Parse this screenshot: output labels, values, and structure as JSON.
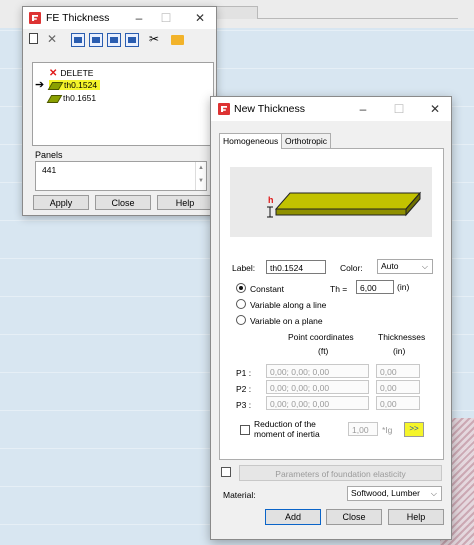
{
  "fe_window": {
    "title": "FE Thickness",
    "list_items": [
      {
        "label": "DELETE",
        "icon": "delete-x-icon"
      },
      {
        "label": "th0.1524",
        "icon": "plate-icon",
        "highlighted": true,
        "current": true
      },
      {
        "label": "th0.1651",
        "icon": "plate-icon"
      }
    ],
    "panels_label": "Panels",
    "panels_value": "441",
    "buttons": {
      "apply": "Apply",
      "close": "Close",
      "help": "Help"
    }
  },
  "nt_window": {
    "title": "New Thickness",
    "tabs": [
      "Homogeneous",
      "Orthotropic"
    ],
    "active_tab": "Homogeneous",
    "preview": {
      "dim_letter": "h"
    },
    "label_caption": "Label:",
    "label_value": "th0.1524",
    "color_caption": "Color:",
    "color_value": "Auto",
    "constant_label": "Constant",
    "th_caption": "Th =",
    "th_value": "6,00",
    "th_unit": "(in)",
    "variable_line_label": "Variable along a line",
    "variable_plane_label": "Variable on a plane",
    "point_coords_header": "Point coordinates",
    "point_coords_unit": "(ft)",
    "thicknesses_header": "Thicknesses",
    "thicknesses_unit": "(in)",
    "points": [
      {
        "label": "P1 :",
        "coords": "0,00; 0,00; 0,00",
        "thickness": "0,00"
      },
      {
        "label": "P2 :",
        "coords": "0,00; 0,00; 0,00",
        "thickness": "0,00"
      },
      {
        "label": "P3 :",
        "coords": "0,00; 0,00; 0,00",
        "thickness": "0,00"
      }
    ],
    "reduction_label_line1": "Reduction of the",
    "reduction_label_line2": "moment of inertia",
    "reduction_value": "1,00",
    "reduction_unit": "*Ig",
    "more_button": ">>",
    "foundation_button": "Parameters of foundation elasticity",
    "material_caption": "Material:",
    "material_value": "Softwood, Lumber",
    "buttons": {
      "add": "Add",
      "close": "Close",
      "help": "Help"
    }
  },
  "colors": {
    "highlight": "#f5f52a",
    "plate": "#9aa30a",
    "app_icon": "#dd3333"
  }
}
